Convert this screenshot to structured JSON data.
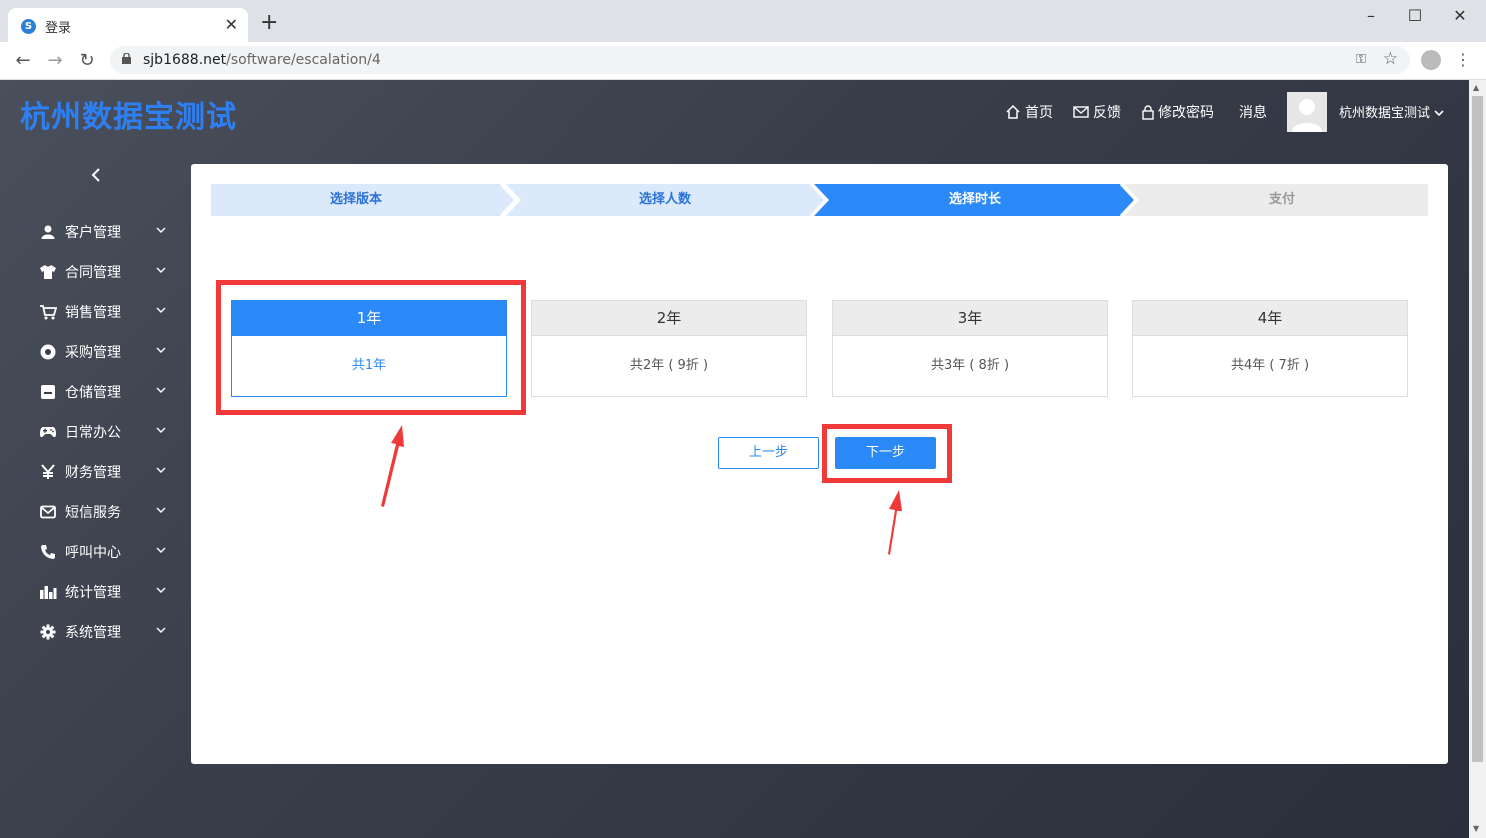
{
  "browser": {
    "tab_title": "登录",
    "url_host": "sjb1688.net",
    "url_path": "/software/escalation/4"
  },
  "header": {
    "brand": "杭州数据宝测试",
    "nav": {
      "home": "首页",
      "feedback": "反馈",
      "change_password": "修改密码",
      "messages": "消息"
    },
    "user_name": "杭州数据宝测试"
  },
  "sidebar": {
    "toggle_icon": "chevron-left-icon",
    "items": [
      {
        "label": "客户管理",
        "icon": "user-icon"
      },
      {
        "label": "合同管理",
        "icon": "shirt-icon"
      },
      {
        "label": "销售管理",
        "icon": "cart-icon"
      },
      {
        "label": "采购管理",
        "icon": "circle-icon"
      },
      {
        "label": "仓储管理",
        "icon": "box-icon"
      },
      {
        "label": "日常办公",
        "icon": "gamepad-icon"
      },
      {
        "label": "财务管理",
        "icon": "yen-icon"
      },
      {
        "label": "短信服务",
        "icon": "envelope-icon"
      },
      {
        "label": "呼叫中心",
        "icon": "phone-icon"
      },
      {
        "label": "统计管理",
        "icon": "chart-icon"
      },
      {
        "label": "系统管理",
        "icon": "gear-icon"
      }
    ]
  },
  "steps": [
    {
      "label": "选择版本",
      "state": "done"
    },
    {
      "label": "选择人数",
      "state": "done"
    },
    {
      "label": "选择时长",
      "state": "active"
    },
    {
      "label": "支付",
      "state": "pending"
    }
  ],
  "plans": [
    {
      "title": "1年",
      "desc": "共1年",
      "selected": true
    },
    {
      "title": "2年",
      "desc": "共2年 ( 9折 )",
      "selected": false
    },
    {
      "title": "3年",
      "desc": "共3年 ( 8折 )",
      "selected": false
    },
    {
      "title": "4年",
      "desc": "共4年 ( 7折 )",
      "selected": false
    }
  ],
  "buttons": {
    "prev": "上一步",
    "next": "下一步"
  },
  "colors": {
    "accent": "#2b8af7",
    "brand": "#2e7ff2",
    "highlight": "#f03a3a",
    "step_done_bg": "#dce9fb",
    "step_pending_bg": "#ececec"
  }
}
